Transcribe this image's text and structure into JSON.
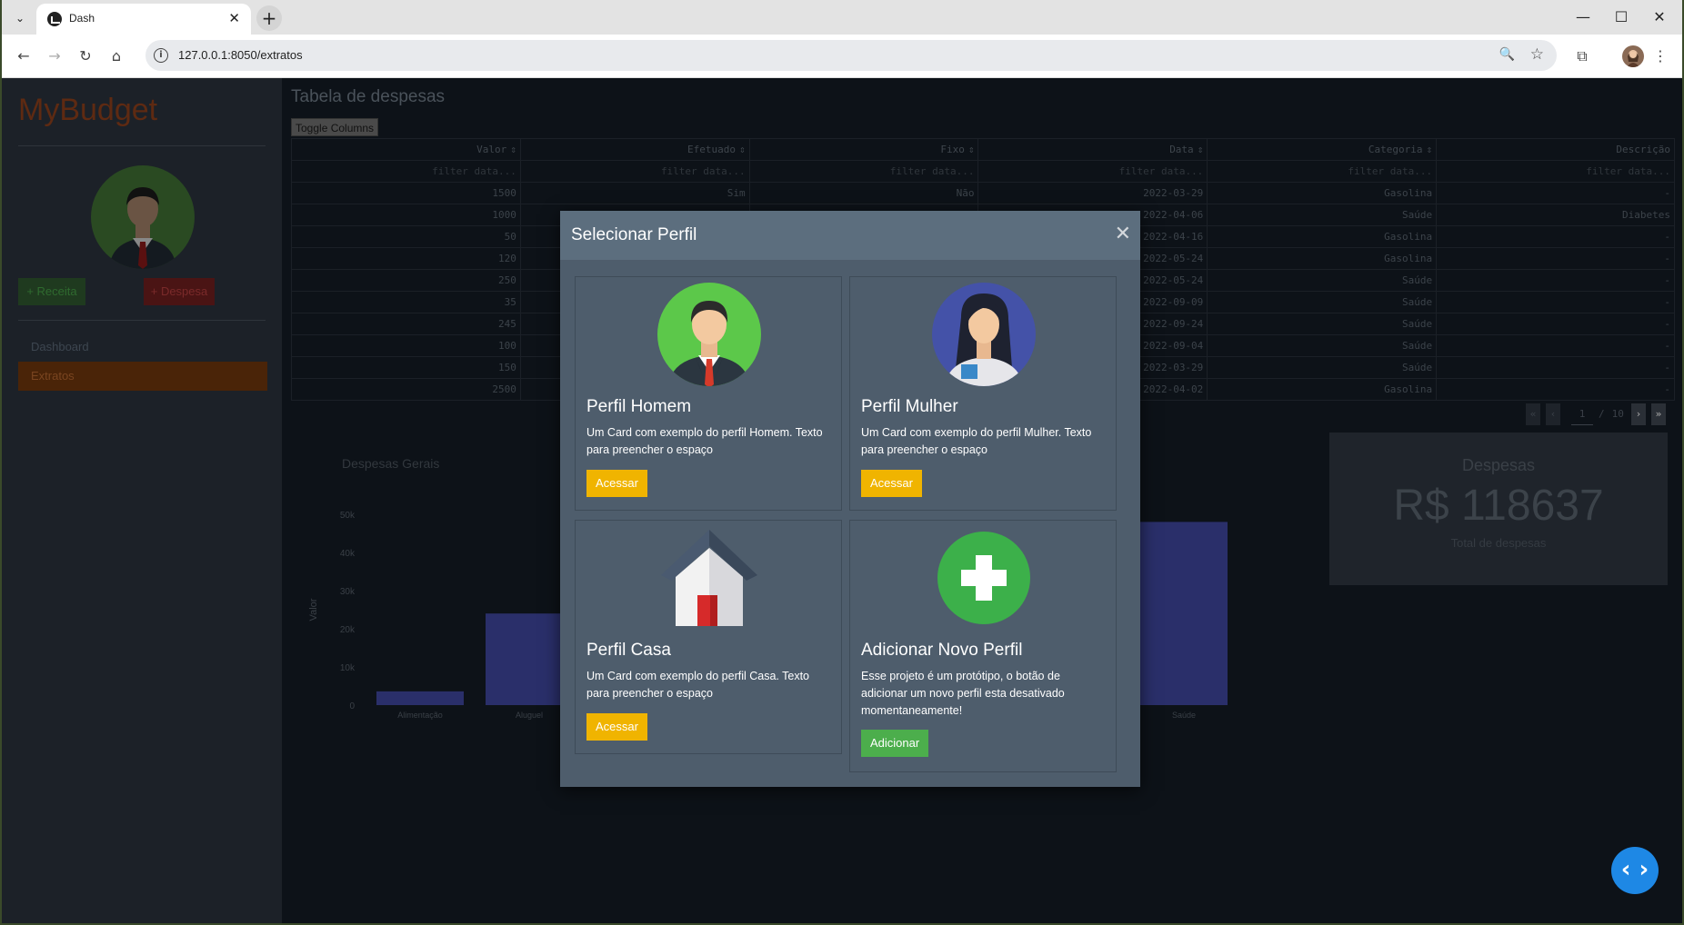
{
  "browser": {
    "tab_title": "Dash",
    "url": "127.0.0.1:8050/extratos",
    "new_tab": "+",
    "tab_close": "✕",
    "tab_list": "⌄",
    "minimize": "—",
    "maximize": "☐",
    "close": "✕",
    "back": "←",
    "forward": "→",
    "reload": "↻",
    "home": "⌂",
    "zoom": "🔍",
    "bookmark": "☆",
    "extensions": "⧉",
    "menu": "⋮",
    "info": "i"
  },
  "sidebar": {
    "brand": "MyBudget",
    "btn_receita": "+ Receita",
    "btn_despesa": "+ Despesa",
    "nav": [
      {
        "label": "Dashboard",
        "active": false
      },
      {
        "label": "Extratos",
        "active": true
      }
    ]
  },
  "main": {
    "title": "Tabela de despesas",
    "toggle_columns": "Toggle Columns",
    "table": {
      "columns": [
        "Valor",
        "Efetuado",
        "Fixo",
        "Data",
        "Categoria",
        "Descrição"
      ],
      "filter_placeholder": "filter data...",
      "sort_icon": "⇕",
      "rows": [
        [
          "1500",
          "Sim",
          "Não",
          "2022-03-29",
          "Gasolina",
          "-"
        ],
        [
          "1000",
          "",
          "",
          "2022-04-06",
          "Saúde",
          "Diabetes"
        ],
        [
          "50",
          "",
          "",
          "2022-04-16",
          "Gasolina",
          "-"
        ],
        [
          "120",
          "",
          "",
          "2022-05-24",
          "Gasolina",
          "-"
        ],
        [
          "250",
          "",
          "",
          "2022-05-24",
          "Saúde",
          "-"
        ],
        [
          "35",
          "",
          "",
          "2022-09-09",
          "Saúde",
          "-"
        ],
        [
          "245",
          "",
          "",
          "2022-09-24",
          "Saúde",
          "-"
        ],
        [
          "100",
          "",
          "",
          "2022-09-04",
          "Saúde",
          "-"
        ],
        [
          "150",
          "",
          "",
          "2022-03-29",
          "Saúde",
          "-"
        ],
        [
          "2500",
          "",
          "",
          "2022-04-02",
          "Gasolina",
          "-"
        ]
      ]
    },
    "pagination": {
      "current": "1",
      "separator": "/",
      "total": "10",
      "first": "«",
      "prev": "‹",
      "next": "›",
      "last": "»"
    },
    "chart_title": "Despesas Gerais",
    "despesas_card": {
      "title": "Despesas",
      "value": "R$ 118637",
      "subtitle": "Total de despesas"
    },
    "fab_icon": "‹ ›"
  },
  "chart_data": {
    "type": "bar",
    "title": "Despesas Gerais",
    "xlabel": "",
    "ylabel": "Valor",
    "categories": [
      "Alimentação",
      "Aluguel",
      "Saúde"
    ],
    "values": [
      3600,
      24000,
      48000
    ],
    "ylim": [
      0,
      50000
    ],
    "yticks": [
      "0",
      "10k",
      "20k",
      "30k",
      "40k",
      "50k"
    ],
    "ytick_values": [
      0,
      10000,
      20000,
      30000,
      40000,
      50000
    ],
    "bar_color": "#2a2f6a"
  },
  "modal": {
    "title": "Selecionar Perfil",
    "close_icon": "✕",
    "cards": [
      {
        "title": "Perfil Homem",
        "text": "Um Card com exemplo do perfil Homem. Texto para preencher o espaço",
        "button": "Acessar",
        "icon": "man-avatar-icon"
      },
      {
        "title": "Perfil Mulher",
        "text": "Um Card com exemplo do perfil Mulher. Texto para preencher o espaço",
        "button": "Acessar",
        "icon": "woman-avatar-icon"
      },
      {
        "title": "Perfil Casa",
        "text": "Um Card com exemplo do perfil Casa. Texto para preencher o espaço",
        "button": "Acessar",
        "icon": "house-icon"
      },
      {
        "title": "Adicionar Novo Perfil",
        "text": "Esse projeto é um protótipo, o botão de adicionar um novo perfil esta desativado momentaneamente!",
        "button": "Adicionar",
        "icon": "plus-circle-icon"
      }
    ]
  },
  "colors": {
    "modal_bg": "#4e5d6c",
    "acessar_button": "#f0b400",
    "adicionar_button": "#4cae4c",
    "fab": "#1e88e5"
  }
}
